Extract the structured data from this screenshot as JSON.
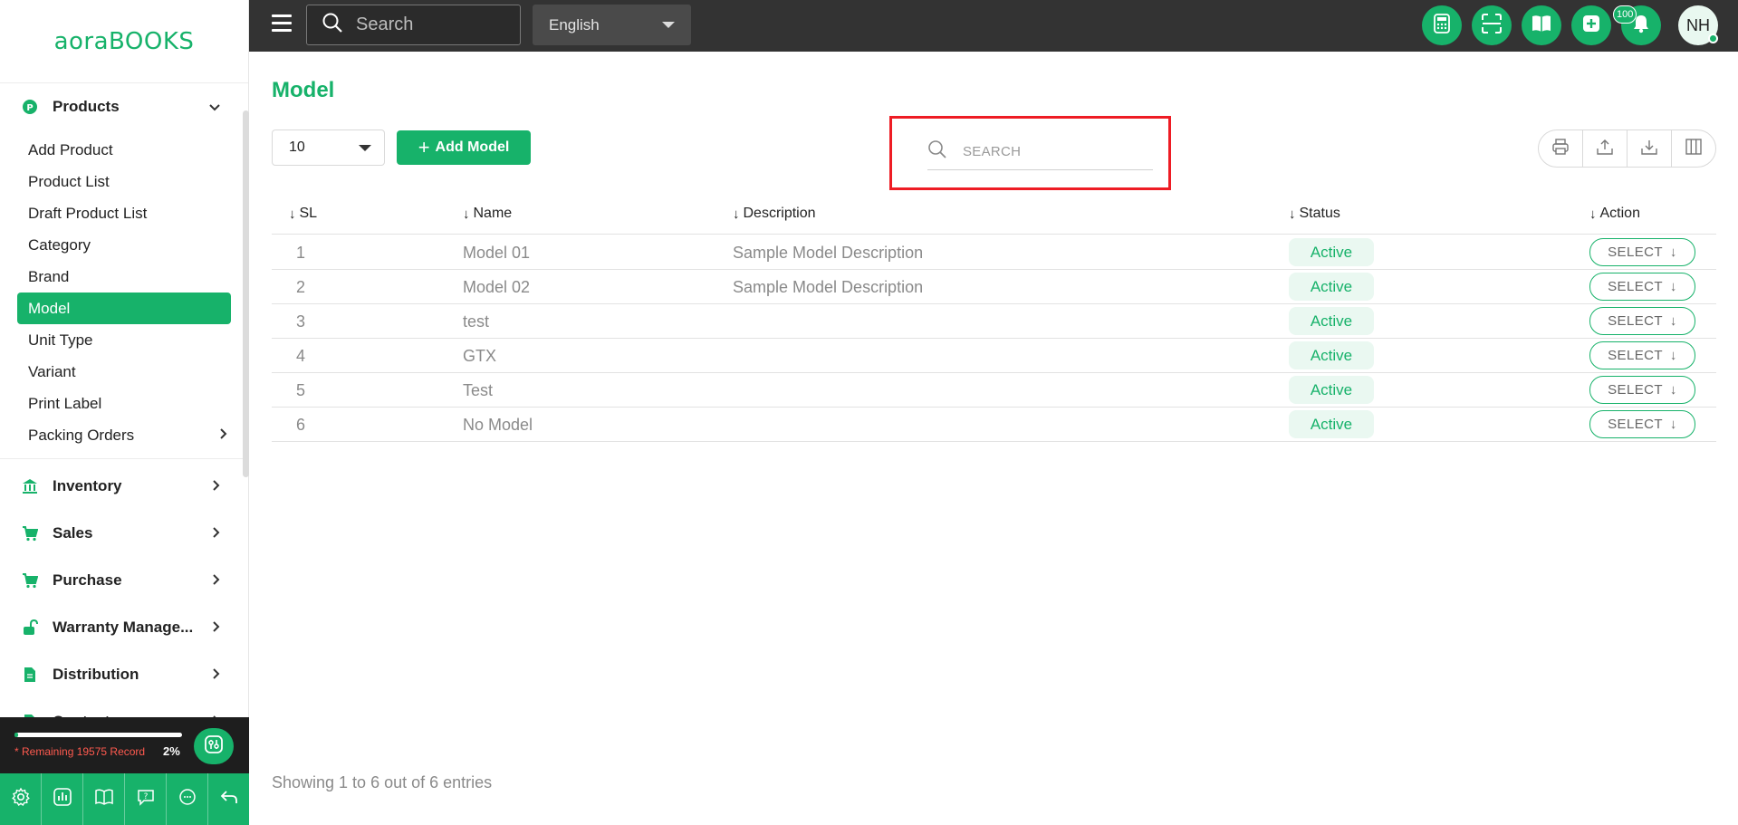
{
  "brand": {
    "logo_text": "aoraBOOKS"
  },
  "sidebar": {
    "products_group": {
      "label": "Products",
      "icon": "products-circle-icon"
    },
    "products_items": [
      {
        "label": "Add Product"
      },
      {
        "label": "Product List"
      },
      {
        "label": "Draft Product List"
      },
      {
        "label": "Category"
      },
      {
        "label": "Brand"
      },
      {
        "label": "Model",
        "active": true
      },
      {
        "label": "Unit Type"
      },
      {
        "label": "Variant"
      },
      {
        "label": "Print Label"
      },
      {
        "label": "Packing Orders"
      }
    ],
    "groups": [
      {
        "label": "Inventory",
        "icon": "bank-icon"
      },
      {
        "label": "Sales",
        "icon": "cart-icon"
      },
      {
        "label": "Purchase",
        "icon": "cart-icon"
      },
      {
        "label": "Warranty Manage...",
        "icon": "unlock-icon"
      },
      {
        "label": "Distribution",
        "icon": "document-icon"
      },
      {
        "label": "Contacts",
        "icon": "document-icon"
      }
    ],
    "record": {
      "remaining_text": "* Remaining 19575 Record",
      "percent_text": "2%",
      "percent_value": 0.02
    },
    "bottom_tools": [
      "settings-gear-icon",
      "bar-chart-icon",
      "book-open-icon",
      "help-chat-icon",
      "support-chat-icon",
      "logout-back-icon"
    ]
  },
  "topbar": {
    "search_placeholder": "Search",
    "language": "English",
    "notification_count": "100",
    "avatar_initials": "NH",
    "icons": [
      "calculator-icon",
      "scan-icon",
      "book-icon",
      "add-square-icon",
      "bell-icon"
    ]
  },
  "main": {
    "title": "Model",
    "page_size": "10",
    "add_button": "Add Model",
    "search_placeholder": "SEARCH",
    "toolbar_icons": [
      "print-icon",
      "upload-icon",
      "download-icon",
      "columns-icon"
    ],
    "columns": [
      "SL",
      "Name",
      "Description",
      "Status",
      "Action"
    ],
    "rows": [
      {
        "sl": "1",
        "name": "Model 01",
        "description": "Sample Model Description",
        "status": "Active",
        "action": "SELECT"
      },
      {
        "sl": "2",
        "name": "Model 02",
        "description": "Sample Model Description",
        "status": "Active",
        "action": "SELECT"
      },
      {
        "sl": "3",
        "name": "test",
        "description": "",
        "status": "Active",
        "action": "SELECT"
      },
      {
        "sl": "4",
        "name": "GTX",
        "description": "",
        "status": "Active",
        "action": "SELECT"
      },
      {
        "sl": "5",
        "name": "Test",
        "description": "",
        "status": "Active",
        "action": "SELECT"
      },
      {
        "sl": "6",
        "name": "No Model",
        "description": "",
        "status": "Active",
        "action": "SELECT"
      }
    ],
    "footer": "Showing 1 to 6 out of 6 entries"
  },
  "colors": {
    "accent": "#17b26a",
    "topbar": "#333333",
    "highlight": "#ee1c24"
  }
}
